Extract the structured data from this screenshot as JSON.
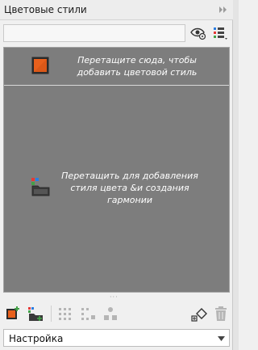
{
  "panel": {
    "title": "Цветовые стили"
  },
  "search": {
    "value": "",
    "placeholder": ""
  },
  "drop_zones": [
    {
      "text": "Перетащите сюда, чтобы добавить цветовой стиль",
      "icon": "color-swatch-icon"
    },
    {
      "text": "Перетащить для добавления стиля цвета &и создания гармонии",
      "icon": "folder-harmony-icon"
    }
  ],
  "toolbar_icons": [
    "new-color-style-icon",
    "new-harmony-icon",
    "apply-grid-icon",
    "harmony-grid-icon",
    "link-objects-icon",
    "convert-style-icon",
    "delete-icon"
  ],
  "dropdown": {
    "selected": "Настройка"
  },
  "colors": {
    "accent_orange": "#e8601c",
    "canvas_gray": "#7d7d7d",
    "panel_bg": "#f0f0f0"
  }
}
